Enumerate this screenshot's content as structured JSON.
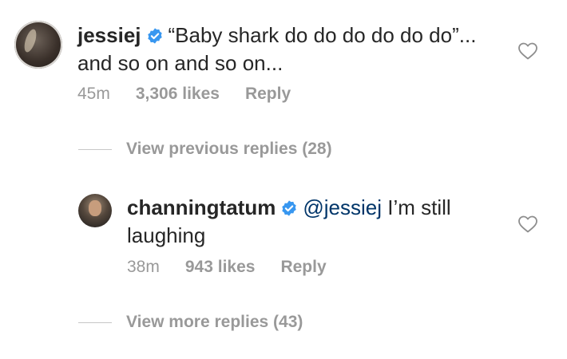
{
  "comment": {
    "username": "jessiej",
    "text": "“Baby shark do do do do do do”... and so on and so on...",
    "time": "45m",
    "likes": "3,306 likes",
    "reply_label": "Reply"
  },
  "view_previous_replies": "View previous replies (28)",
  "reply": {
    "username": "channingtatum",
    "mention": "@jessiej",
    "text": " I’m still laughing",
    "time": "38m",
    "likes": "943 likes",
    "reply_label": "Reply"
  },
  "view_more_replies": "View more replies (43)",
  "icons": {
    "verified": "verified-badge-icon",
    "like": "heart-icon"
  },
  "colors": {
    "verified": "#3897f0",
    "mention": "#003569",
    "meta": "#999999",
    "text": "#262626"
  }
}
